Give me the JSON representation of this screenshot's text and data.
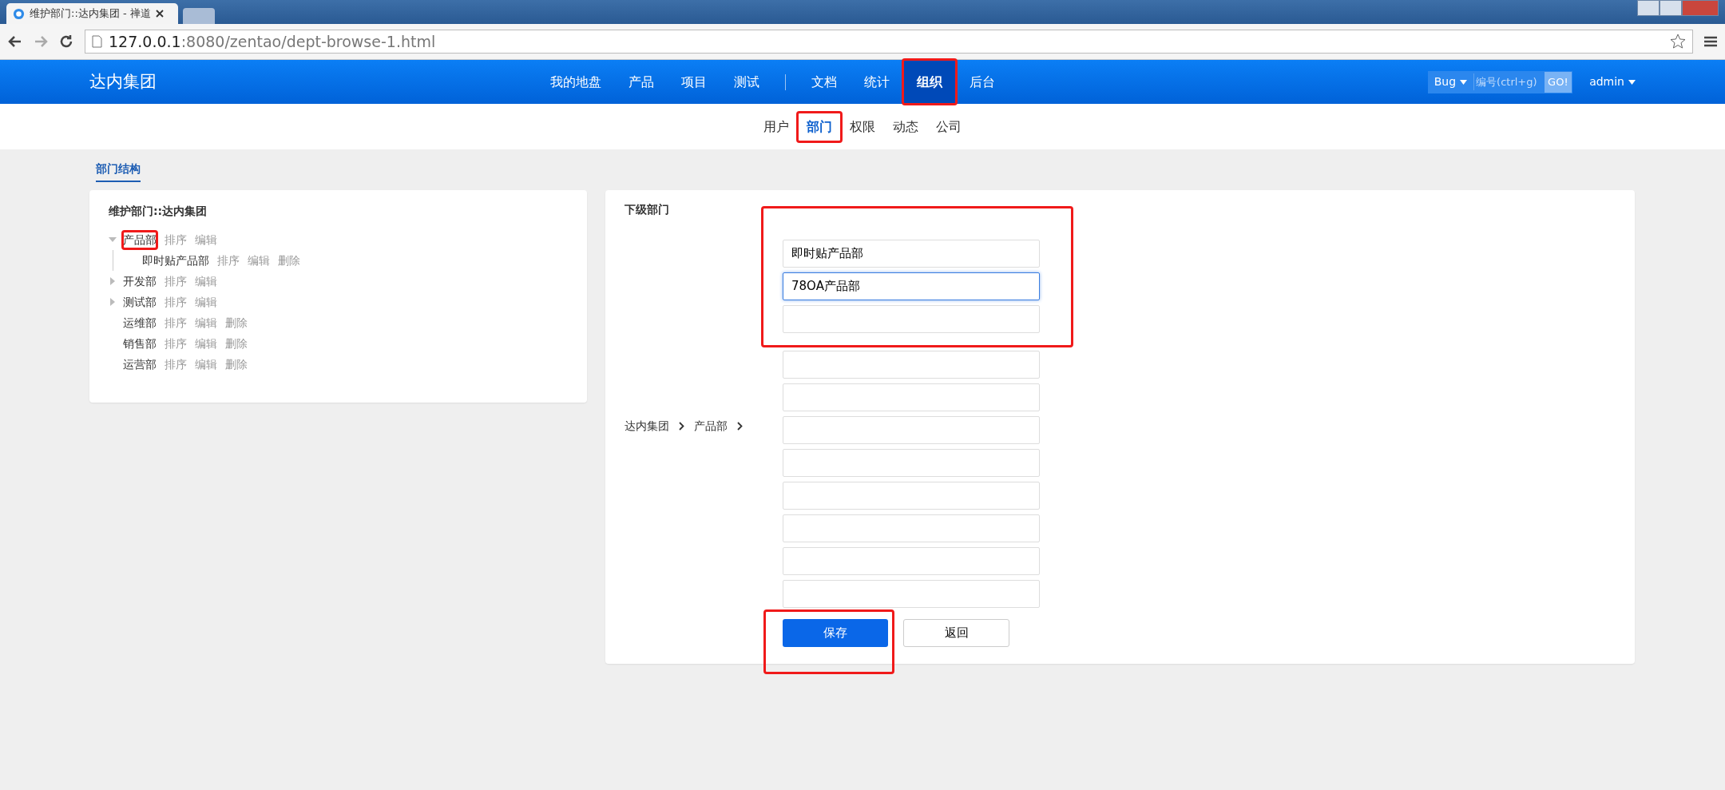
{
  "browser": {
    "tab_title": "维护部门::达内集团 - 禅道",
    "url_host": "127.0.0.1",
    "url_rest": ":8080/zentao/dept-browse-1.html"
  },
  "navbar": {
    "brand": "达内集团",
    "items": [
      {
        "label": "我的地盘",
        "selected": false,
        "highlighted": false
      },
      {
        "label": "产品",
        "selected": false,
        "highlighted": false
      },
      {
        "label": "项目",
        "selected": false,
        "highlighted": false
      },
      {
        "label": "测试",
        "selected": false,
        "highlighted": false,
        "divider_after": true
      },
      {
        "label": "文档",
        "selected": false,
        "highlighted": false
      },
      {
        "label": "统计",
        "selected": false,
        "highlighted": false
      },
      {
        "label": "组织",
        "selected": true,
        "highlighted": true
      },
      {
        "label": "后台",
        "selected": false,
        "highlighted": false
      }
    ],
    "search_type": "Bug",
    "search_placeholder": "编号(ctrl+g)",
    "go": "GO!",
    "user": "admin"
  },
  "subnav": [
    {
      "label": "用户",
      "selected": false,
      "highlighted": false
    },
    {
      "label": "部门",
      "selected": true,
      "highlighted": true
    },
    {
      "label": "权限",
      "selected": false,
      "highlighted": false
    },
    {
      "label": "动态",
      "selected": false,
      "highlighted": false
    },
    {
      "label": "公司",
      "selected": false,
      "highlighted": false
    }
  ],
  "page_tab": "部门结构",
  "tree_panel": {
    "title": "维护部门::达内集团",
    "nodes": [
      {
        "name": "产品部",
        "expanded": true,
        "highlighted": true,
        "actions": [
          "排序",
          "编辑"
        ],
        "children": [
          {
            "name": "即时贴产品部",
            "highlighted": false,
            "actions": [
              "排序",
              "编辑",
              "删除"
            ]
          }
        ]
      },
      {
        "name": "开发部",
        "expanded": false,
        "highlighted": false,
        "actions": [
          "排序",
          "编辑"
        ]
      },
      {
        "name": "测试部",
        "expanded": false,
        "highlighted": false,
        "actions": [
          "排序",
          "编辑"
        ]
      },
      {
        "name": "运维部",
        "highlighted": false,
        "actions": [
          "排序",
          "编辑",
          "删除"
        ]
      },
      {
        "name": "销售部",
        "highlighted": false,
        "actions": [
          "排序",
          "编辑",
          "删除"
        ]
      },
      {
        "name": "运营部",
        "highlighted": false,
        "actions": [
          "排序",
          "编辑",
          "删除"
        ]
      }
    ]
  },
  "form_panel": {
    "title": "下级部门",
    "breadcrumb": [
      "达内集团",
      "产品部"
    ],
    "input_groups": [
      {
        "highlighted": true,
        "inputs": [
          {
            "value": "即时贴产品部",
            "focused": false
          },
          {
            "value": "78OA产品部",
            "focused": true
          },
          {
            "focused": false
          }
        ]
      },
      {
        "highlighted": false,
        "inputs": [
          {
            "focused": false
          },
          {
            "focused": false
          },
          {
            "focused": false
          },
          {
            "focused": false
          },
          {
            "focused": false
          },
          {
            "focused": false
          },
          {
            "focused": false
          },
          {
            "focused": false
          }
        ]
      }
    ],
    "save": {
      "label": "保存",
      "highlighted": true
    },
    "back": "返回"
  }
}
